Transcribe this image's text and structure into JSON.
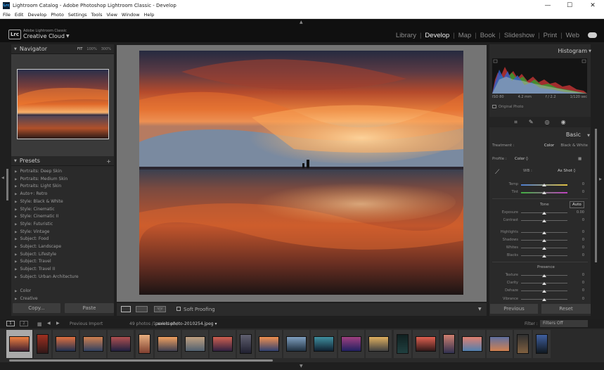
{
  "window": {
    "title": "Lightroom Catalog - Adobe Photoshop Lightroom Classic - Develop",
    "app_icon": "Lrc",
    "controls": {
      "minimize": "—",
      "maximize": "☐",
      "close": "✕"
    }
  },
  "menubar": [
    "File",
    "Edit",
    "Develop",
    "Photo",
    "Settings",
    "Tools",
    "View",
    "Window",
    "Help"
  ],
  "identity": {
    "logo": "Lrc",
    "line1": "Adobe Lightroom Classic",
    "line2": "Creative Cloud",
    "caret": "▼"
  },
  "modules": [
    {
      "label": "Library",
      "active": false
    },
    {
      "label": "Develop",
      "active": true
    },
    {
      "label": "Map",
      "active": false
    },
    {
      "label": "Book",
      "active": false
    },
    {
      "label": "Slideshow",
      "active": false
    },
    {
      "label": "Print",
      "active": false
    },
    {
      "label": "Web",
      "active": false
    }
  ],
  "module_separator": "|",
  "navigator": {
    "title": "Navigator",
    "options": [
      "FIT",
      "100%",
      "300%"
    ]
  },
  "presets": {
    "title": "Presets",
    "plus": "+",
    "items": [
      "Portraits: Deep Skin",
      "Portraits: Medium Skin",
      "Portraits: Light Skin",
      "Auto+: Retro",
      "Style: Black & White",
      "Style: Cinematic",
      "Style: Cinematic II",
      "Style: Futuristic",
      "Style: Vintage",
      "Subject: Food",
      "Subject: Landscape",
      "Subject: Lifestyle",
      "Subject: Travel",
      "Subject: Travel II",
      "Subject: Urban Architecture"
    ],
    "groups": [
      "Color",
      "Creative"
    ]
  },
  "left_buttons": {
    "copy": "Copy...",
    "paste": "Paste"
  },
  "toolbar": {
    "soft_proofing": "Soft Proofing",
    "ba_label": "Y|Y"
  },
  "histogram": {
    "title": "Histogram",
    "info": [
      "ISO 80",
      "4.2 mm",
      "f / 2.2",
      "1/120 sec"
    ],
    "original_photo": "Original Photo"
  },
  "basic": {
    "title": "Basic",
    "treatment_label": "Treatment :",
    "treatment_options": [
      "Color",
      "Black & White"
    ],
    "profile_label": "Profile :",
    "profile_value": "Color ◊",
    "wb_label": "WB :",
    "wb_value": "As Shot ◊",
    "tone_label": "Tone",
    "auto_label": "Auto",
    "presence_label": "Presence",
    "sliders": [
      {
        "label": "Temp",
        "value": "0",
        "pos": 0.5
      },
      {
        "label": "Tint",
        "value": "0",
        "pos": 0.5
      },
      {
        "label": "Exposure",
        "value": "0.00",
        "pos": 0.5
      },
      {
        "label": "Contrast",
        "value": "0",
        "pos": 0.5
      },
      {
        "label": "Highlights",
        "value": "0",
        "pos": 0.5
      },
      {
        "label": "Shadows",
        "value": "0",
        "pos": 0.5
      },
      {
        "label": "Whites",
        "value": "0",
        "pos": 0.5
      },
      {
        "label": "Blacks",
        "value": "0",
        "pos": 0.5
      },
      {
        "label": "Texture",
        "value": "0",
        "pos": 0.5
      },
      {
        "label": "Clarity",
        "value": "0",
        "pos": 0.5
      },
      {
        "label": "Dehaze",
        "value": "0",
        "pos": 0.5
      },
      {
        "label": "Vibrance",
        "value": "0",
        "pos": 0.5
      }
    ]
  },
  "right_buttons": {
    "previous": "Previous",
    "reset": "Reset"
  },
  "filmbar": {
    "view1": "1",
    "view2": "2",
    "previous_import": "Previous Import",
    "count": "49 photos /1 selected /",
    "filename": "pexels-photo-2010254.jpeg",
    "filename_suffix": "▾",
    "filter_label": "Filter :",
    "filter_value": "Filters Off"
  },
  "colors": {
    "accent": "#31a8ff",
    "panel": "#2a2a2a",
    "background": "#1f1f1f"
  }
}
